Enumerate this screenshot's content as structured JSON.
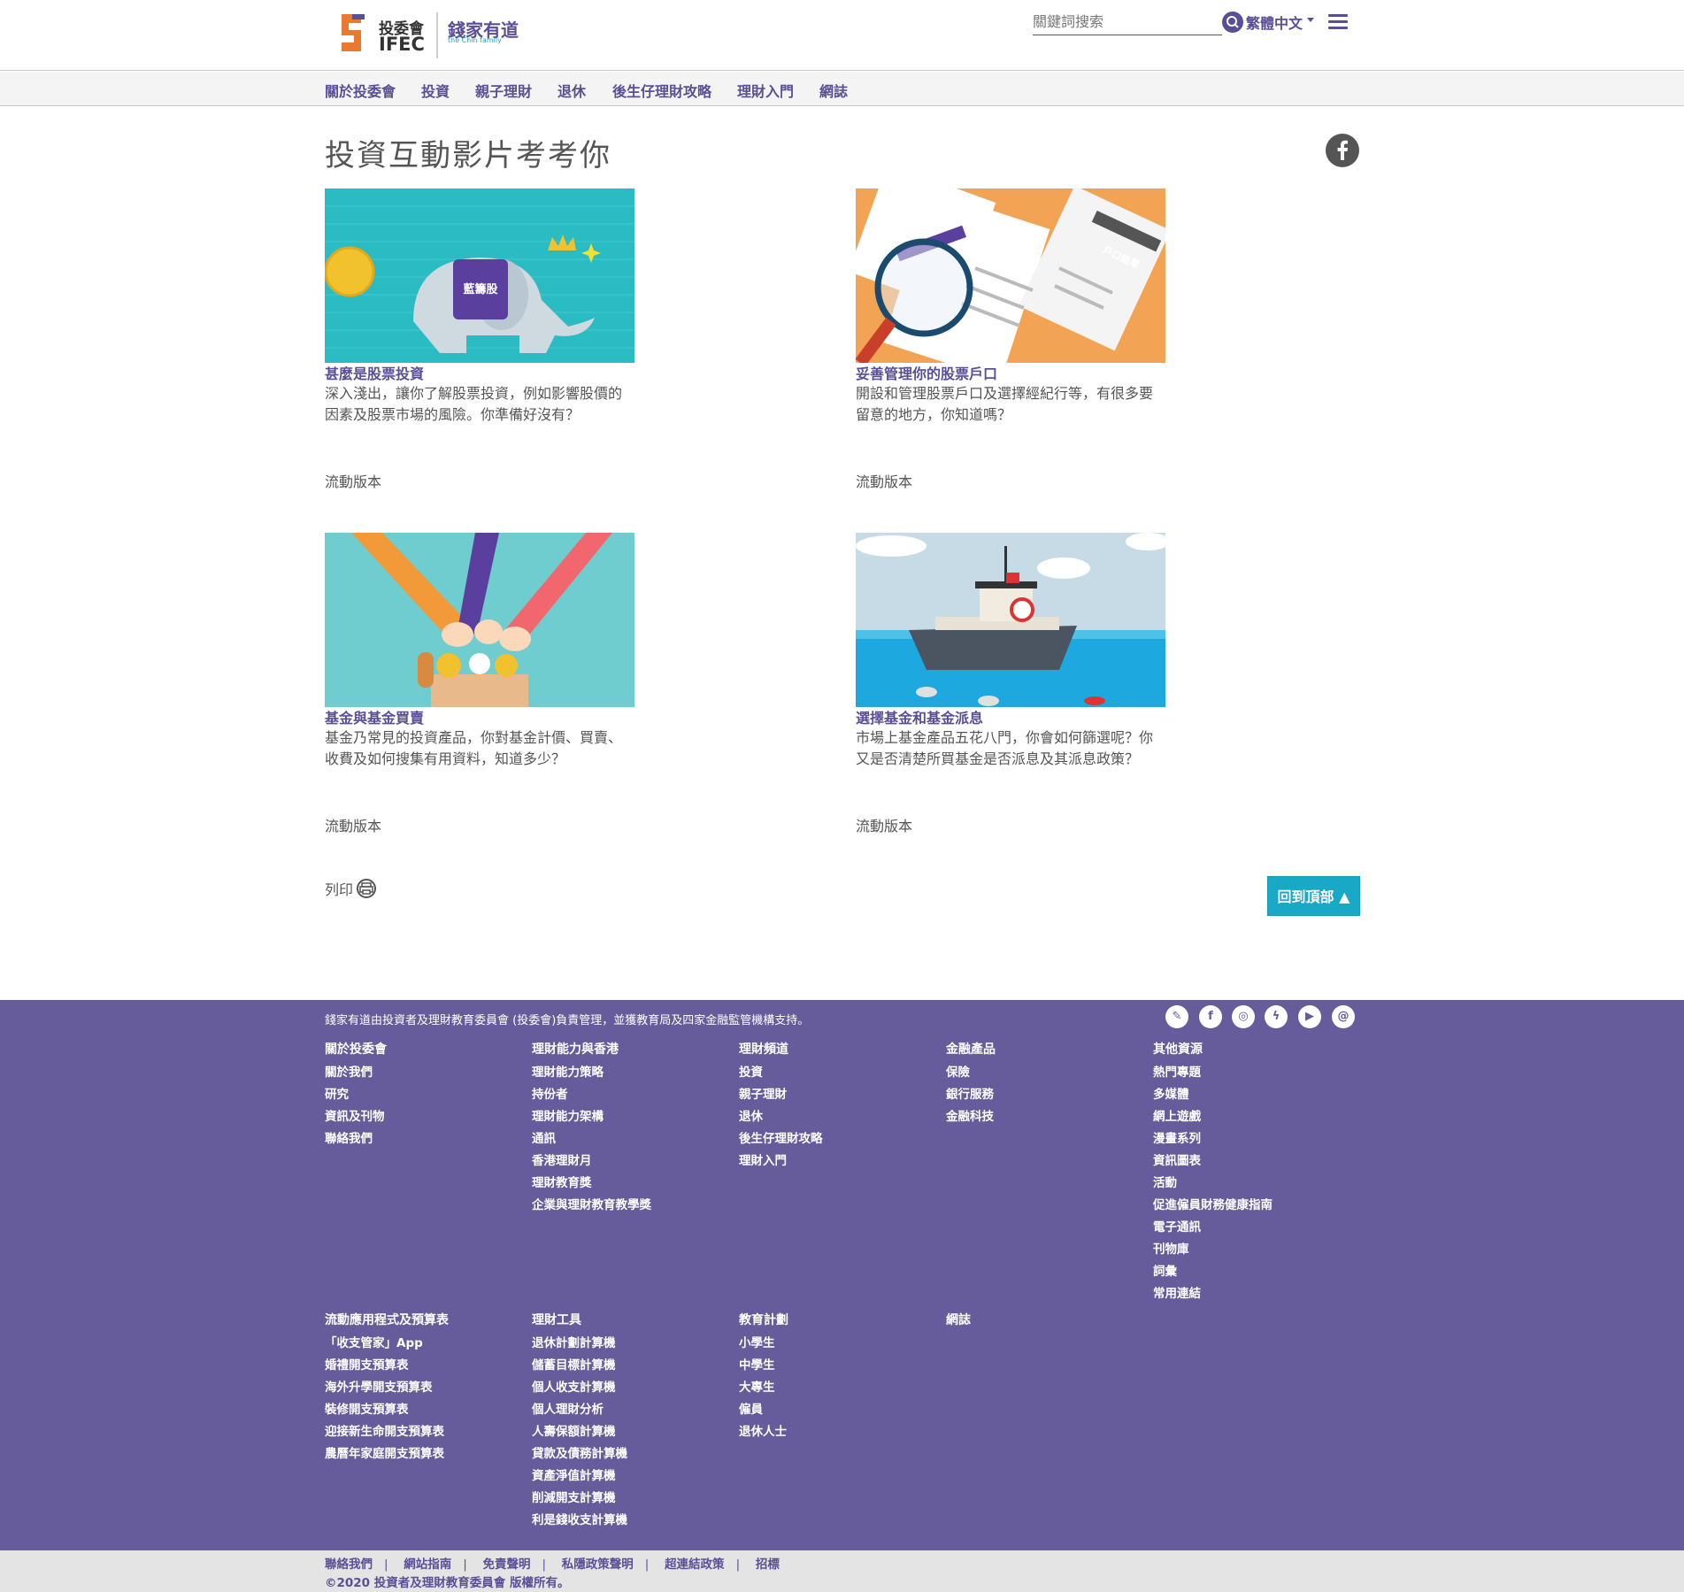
{
  "header": {
    "logo_main": "投委會",
    "logo_sub": "IFEC",
    "logo_brand": "錢家有道",
    "logo_brand_en": "the Chin family",
    "search_placeholder": "關鍵詞搜索",
    "language": "繁體中文"
  },
  "nav": {
    "items": [
      "關於投委會",
      "投資",
      "親子理財",
      "退休",
      "後生仔理財攻略",
      "理財入門",
      "網誌"
    ]
  },
  "main": {
    "title": "投資互動影片考考你",
    "cards": [
      {
        "title": "甚麼是股票投資",
        "desc": "深入淺出，讓你了解股票投資，例如影響股價的因素及股票市場的風險。你準備好沒有？",
        "mobile": "流動版本",
        "image_label": "藍籌股"
      },
      {
        "title": "妥善管理你的股票戶口",
        "desc": "開設和管理股票戶口及選擇經紀行等，有很多要留意的地方，你知道嗎？",
        "mobile": "流動版本",
        "image_label": "戶口結單"
      },
      {
        "title": "基金與基金買賣",
        "desc": "基金乃常見的投資產品，你對基金計價、買賣、收費及如何搜集有用資料，知道多少？",
        "mobile": "流動版本"
      },
      {
        "title": "選擇基金和基金派息",
        "desc": "市場上基金產品五花八門，你會如何篩選呢？你又是否清楚所買基金是否派息及其派息政策？",
        "mobile": "流動版本"
      }
    ],
    "print_label": "列印",
    "back_to_top": "回到頂部 ▲"
  },
  "footer": {
    "intro": "錢家有道由投資者及理財教育委員會 (投委會)負責管理，並獲教育局及四家金融監管機構支持。",
    "social_icons": [
      "blog-icon",
      "facebook-icon",
      "instagram-icon",
      "messenger-icon",
      "youtube-icon",
      "email-icon"
    ],
    "columns_row1": [
      {
        "heading": "關於投委會",
        "links": [
          "關於我們",
          "研究",
          "資訊及刊物",
          "聯絡我們"
        ]
      },
      {
        "heading": "理財能力與香港",
        "links": [
          "理財能力策略",
          "持份者",
          "理財能力架構",
          "通訊",
          "香港理財月",
          "理財教育獎",
          "企業與理財教育教學獎"
        ]
      },
      {
        "heading": "理財頻道",
        "links": [
          "投資",
          "親子理財",
          "退休",
          "後生仔理財攻略",
          "理財入門"
        ]
      },
      {
        "heading": "金融產品",
        "links": [
          "保險",
          "銀行服務",
          "金融科技"
        ]
      },
      {
        "heading": "其他資源",
        "links": [
          "熱門專題",
          "多媒體",
          "網上遊戲",
          "漫畫系列",
          "資訊圖表",
          "活動",
          "促進僱員財務健康指南",
          "電子通訊",
          "刊物庫",
          "詞彙",
          "常用連結"
        ]
      }
    ],
    "columns_row2": [
      {
        "heading": "流動應用程式及預算表",
        "links": [
          "「收支管家」App",
          "婚禮開支預算表",
          "海外升學開支預算表",
          "裝修開支預算表",
          "迎接新生命開支預算表",
          "農曆年家庭開支預算表"
        ]
      },
      {
        "heading": "理財工具",
        "links": [
          "退休計劃計算機",
          "儲蓄目標計算機",
          "個人收支計算機",
          "個人理財分析",
          "人壽保額計算機",
          "貸款及債務計算機",
          "資產淨值計算機",
          "削減開支計算機",
          "利是錢收支計算機"
        ]
      },
      {
        "heading": "教育計劃",
        "links": [
          "小學生",
          "中學生",
          "大專生",
          "僱員",
          "退休人士"
        ]
      },
      {
        "heading": "網誌",
        "links": []
      }
    ],
    "bottom_links": [
      "聯絡我們",
      "網站指南",
      "免責聲明",
      "私隱政策聲明",
      "超連結政策",
      "招標"
    ],
    "copyright": "©2020 投資者及理財教育委員會 版權所有。"
  },
  "colors": {
    "brand_purple": "#5a4f96",
    "footer_bg": "#665c9b",
    "accent_teal": "#1aa8c7"
  }
}
